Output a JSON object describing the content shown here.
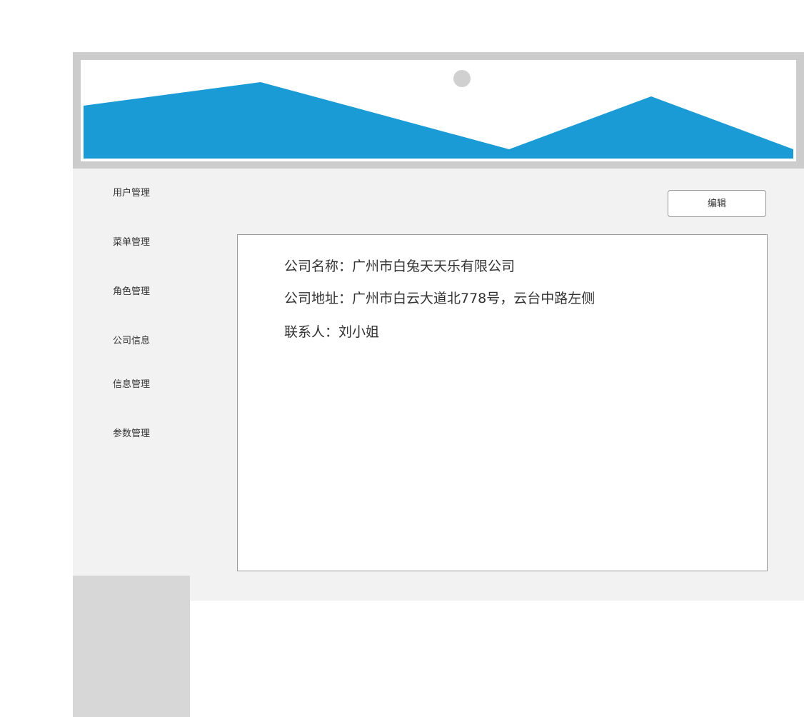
{
  "banner": {
    "image": "landscape-placeholder",
    "colors": {
      "frame": "#cccccc",
      "mountain": "#1a9bd6",
      "sun": "#d0d0d0"
    }
  },
  "sidebar": {
    "items": [
      {
        "label": "用户管理"
      },
      {
        "label": "菜单管理"
      },
      {
        "label": "角色管理"
      },
      {
        "label": "公司信息"
      },
      {
        "label": "信息管理"
      },
      {
        "label": "参数管理"
      }
    ]
  },
  "toolbar": {
    "edit_label": "编辑"
  },
  "company": {
    "name_line": "公司名称：广州市白兔天天乐有限公司",
    "address_line": "公司地址：广州市白云大道北778号，云台中路左侧",
    "contact_line": "联系人：刘小姐"
  }
}
